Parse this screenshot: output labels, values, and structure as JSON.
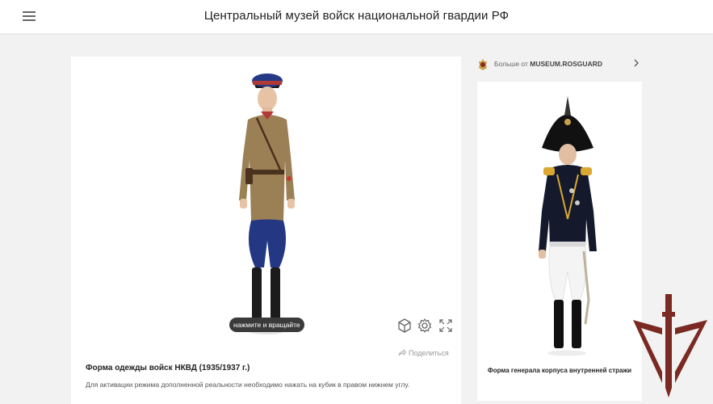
{
  "header": {
    "title": "Центральный музей войск национальной гвардии РФ",
    "menu_icon": "hamburger-menu-icon"
  },
  "viewer": {
    "hint": "нажмите и вращайте",
    "controls": [
      "ar-cube-icon",
      "settings-gear-icon",
      "fullscreen-icon"
    ],
    "share_label": "Поделиться",
    "title": "Форма одежды войск НКВД (1935/1937 г.)",
    "description": "Для активации режима дополненной реальности необходимо нажать на кубик в правом нижнем углу."
  },
  "sidebar": {
    "more_prefix": "Больше от",
    "more_owner": "MUSEUM.ROSGUARD",
    "card_title": "Форма генерала корпуса внутренней стражи"
  },
  "colors": {
    "watermark": "#7a2a22",
    "accent": "#222222",
    "background": "#f2f2f2"
  }
}
